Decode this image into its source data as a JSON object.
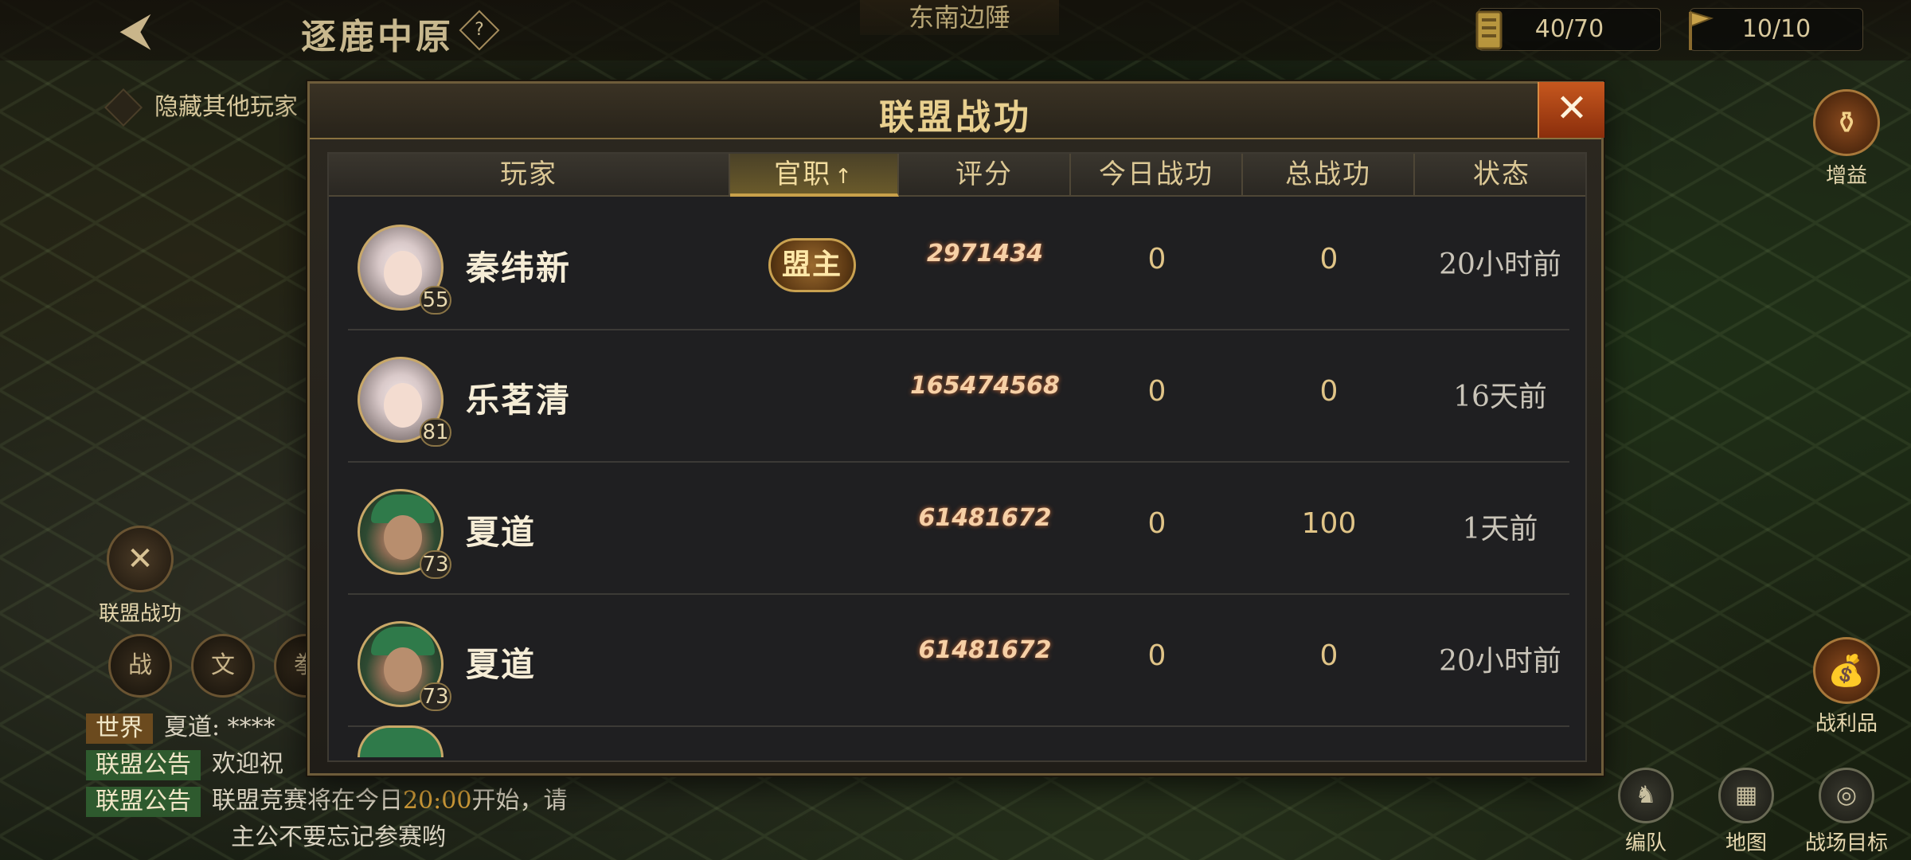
{
  "topbar": {
    "map_title": "逐鹿中原",
    "help": "?",
    "region": "东南边陲",
    "resources": [
      {
        "icon": "order-token-icon",
        "value": "40/70"
      },
      {
        "icon": "flag-token-icon",
        "value": "10/10"
      }
    ]
  },
  "left": {
    "hide_toggle_label": "隐藏其他玩家",
    "alliance_merit_label": "联盟战功",
    "round_buttons": [
      "战",
      "文",
      "拳"
    ]
  },
  "chat": [
    {
      "tag": "世界",
      "text": "夏道: ****"
    },
    {
      "tag": "联盟公告",
      "text": "欢迎祝"
    },
    {
      "tag": "联盟公告",
      "text_before": "联盟竞赛将在今日",
      "highlight": "20:00",
      "text_after": "开始，请",
      "text_wrap": "主公不要忘记参赛哟"
    }
  ],
  "right": {
    "buff_label": "增益",
    "loot_label": "战利品",
    "bottom_buttons": [
      "编队",
      "地图",
      "战场目标"
    ]
  },
  "dialog": {
    "title": "联盟战功",
    "close": "✕",
    "columns": {
      "player": "玩家",
      "rank": "官职",
      "rank_arrow": "↑",
      "score": "评分",
      "today_merit": "今日战功",
      "total_merit": "总战功",
      "status": "状态"
    },
    "rows": [
      {
        "name": "秦纬新",
        "level": "55",
        "avatar": "silver",
        "rank": "盟主",
        "score": "2971434",
        "today": "0",
        "total": "0",
        "status": "20小时前"
      },
      {
        "name": "乐茗清",
        "level": "81",
        "avatar": "silver",
        "rank": "",
        "score": "165474568",
        "today": "0",
        "total": "0",
        "status": "16天前"
      },
      {
        "name": "夏道",
        "level": "73",
        "avatar": "green",
        "rank": "",
        "score": "61481672",
        "today": "0",
        "total": "100",
        "status": "1天前"
      },
      {
        "name": "夏道",
        "level": "73",
        "avatar": "green",
        "rank": "",
        "score": "61481672",
        "today": "0",
        "total": "0",
        "status": "20小时前"
      }
    ]
  }
}
